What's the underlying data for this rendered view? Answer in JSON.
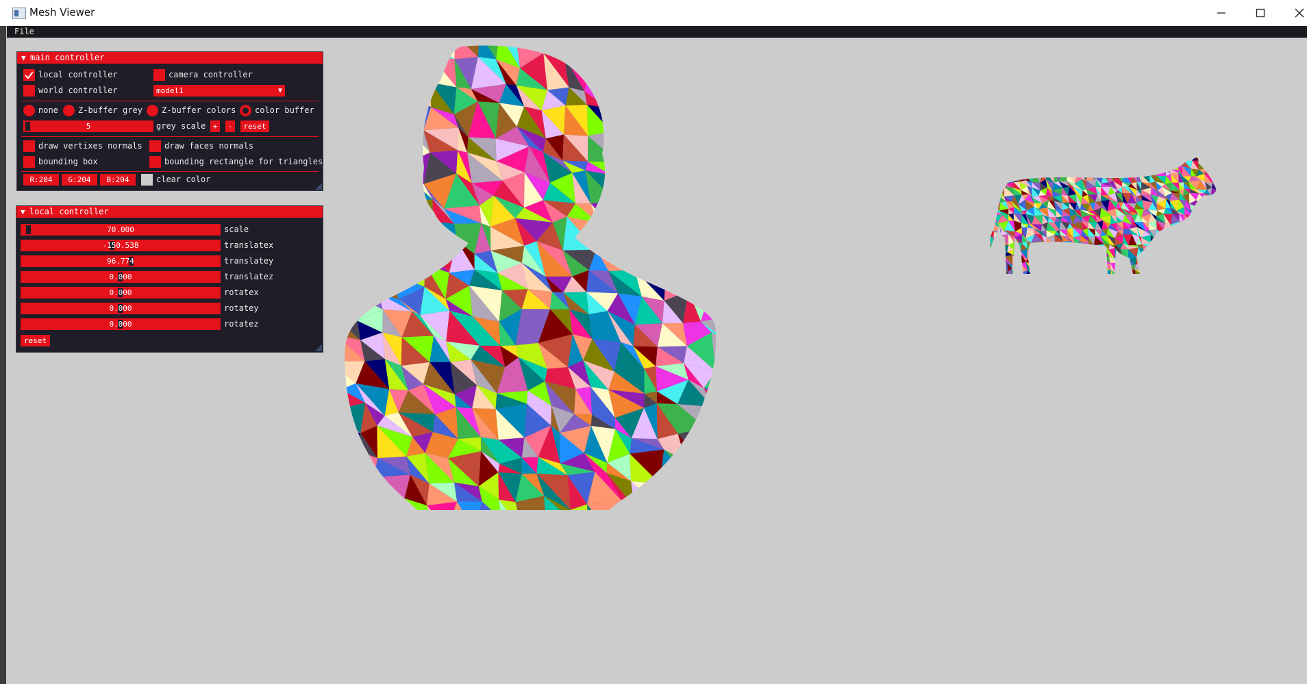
{
  "window": {
    "title": "Mesh Viewer"
  },
  "menu": {
    "file": "File"
  },
  "main_controller": {
    "title": "main controller",
    "local_controller": {
      "label": "local controller",
      "checked": true
    },
    "camera_controller": {
      "label": "camera controller",
      "checked": false
    },
    "world_controller": {
      "label": "world controller",
      "checked": false
    },
    "model_select": "model1",
    "render_modes": [
      {
        "label": "none",
        "selected": false
      },
      {
        "label": "Z-buffer grey",
        "selected": false
      },
      {
        "label": "Z-buffer colors",
        "selected": false
      },
      {
        "label": "color buffer",
        "selected": true
      }
    ],
    "grey_scale": {
      "value": "5",
      "label": "grey scale",
      "plus": "+",
      "minus": "-",
      "reset": "reset"
    },
    "draw_vertex_normals": "draw vertixes normals",
    "draw_face_normals": "draw faces normals",
    "bounding_box": "bounding box",
    "bounding_rect": "bounding rectangle for triangles",
    "clear_color": {
      "r": "R:204",
      "g": "G:204",
      "b": "B:204",
      "label": "clear color",
      "value": "#cccccc"
    }
  },
  "local_controller": {
    "title": "local controller",
    "sliders": [
      {
        "label": "scale",
        "value": "70.000"
      },
      {
        "label": "translatex",
        "value": "-150.538"
      },
      {
        "label": "translatey",
        "value": "96.774"
      },
      {
        "label": "translatez",
        "value": "0.000"
      },
      {
        "label": "rotatex",
        "value": "0.000"
      },
      {
        "label": "rotatey",
        "value": "0.000"
      },
      {
        "label": "rotatez",
        "value": "0.000"
      }
    ],
    "reset": "reset"
  },
  "colors": {
    "accent": "#e5111b",
    "panel_bg": "#1e1d28",
    "viewport_bg": "#cccccc"
  }
}
